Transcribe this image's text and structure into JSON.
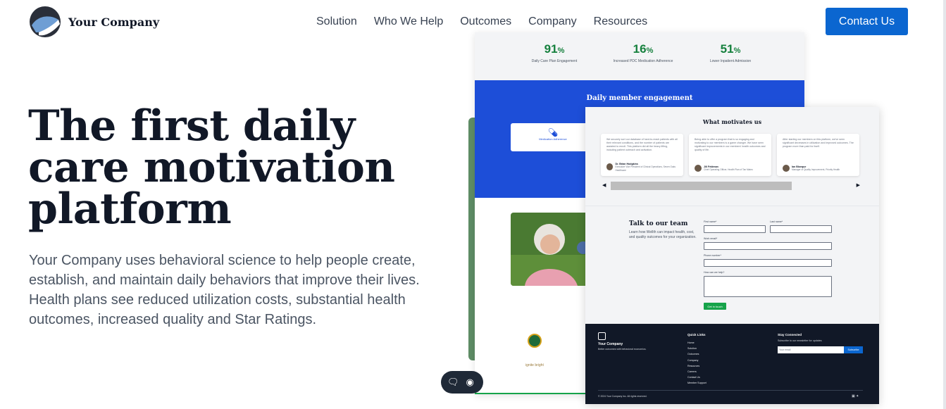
{
  "brand": {
    "name": "Your Company"
  },
  "nav": {
    "items": [
      "Solution",
      "Who We Help",
      "Outcomes",
      "Company",
      "Resources"
    ]
  },
  "header": {
    "cta_label": "Contact Us"
  },
  "hero": {
    "title": "The first daily care motivation platform",
    "description": "Your Company uses behavioral science to help people create, establish, and maintain daily behaviors that improve their lives. Health plans see reduced utilization costs, substantial health outcomes, increased quality and Star Ratings."
  },
  "mockup_back": {
    "stats": [
      {
        "value": "91",
        "unit": "%",
        "label": "Daily Care Plan Engagement"
      },
      {
        "value": "16",
        "unit": "%",
        "label": "Increased PDC Medication Adherence"
      },
      {
        "value": "51",
        "unit": "%",
        "label": "Lower Inpatient Admission"
      }
    ],
    "band_title": "Daily member engagement",
    "card_label": "Medication Adherence",
    "partner_label": "ignite bright"
  },
  "mockup_front": {
    "section_title": "What motivates us",
    "testimonials": [
      {
        "quote": "We securely sort our database of hard-to-reach patients with all their relevant conditions, and the number of patients are assisted to enroll. This platform did all the heavy lifting, including patient outreach and activation.",
        "name": "Dr. Brian Hodgkins",
        "role": "Executive Vice President of Clinical Operations, Seven Oaks Healthcare"
      },
      {
        "quote": "Being able to offer a program that is so engaging and motivating to our members is a game changer. We have seen significant improvements in our members' health outcomes and quality of life.",
        "name": "Jill Feldman",
        "role": "Chief Operating Officer, Health Plan of Tan Mateo"
      },
      {
        "quote": "After starting our members on this platform, we've seen significant decreases in utilization and improved outcomes. The program more than paid for itself.",
        "name": "Ian Bloeque",
        "role": "Manager of Quality Improvement, Priority Health"
      }
    ],
    "form": {
      "title": "Talk to our team",
      "description": "Learn how Wellth can impact health, cost, and quality outcomes for your organization.",
      "labels": {
        "first": "First name*",
        "last": "Last name*",
        "email": "Work email*",
        "phone": "Phone number*",
        "help": "How can we help?"
      },
      "submit": "Get in touch"
    },
    "footer": {
      "brand": "Your Company",
      "tagline": "Better outcomes with behavioral economics.",
      "quick_links_title": "Quick Links",
      "quick_links": [
        "Home",
        "Solution",
        "Outcomes",
        "Company",
        "Resources",
        "Careers",
        "Contact Us",
        "Member Support"
      ],
      "stay_title": "Stay Connected",
      "stay_desc": "Subscribe to our newsletter for updates",
      "email_placeholder": "Your email",
      "subscribe": "Subscribe",
      "copyright": "© 2024 Your Company Inc. All rights reserved."
    }
  },
  "colors": {
    "accent": "#0b66d0",
    "stat_green": "#15803d",
    "band_blue": "#1d4ed8",
    "footer": "#111827"
  }
}
